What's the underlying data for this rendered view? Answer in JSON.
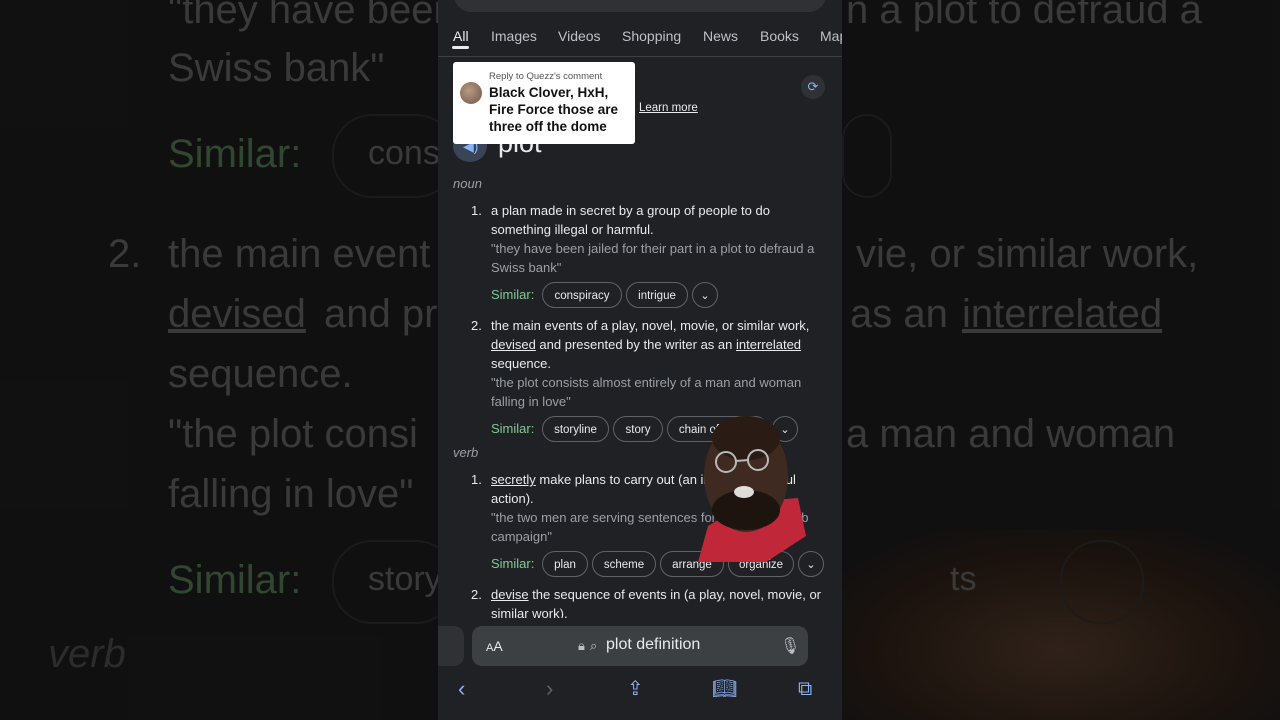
{
  "background": {
    "lines": [
      "\"they have been",
      "n a plot to defraud a",
      "Swiss bank\"",
      "Similar:",
      "cons",
      "2.",
      "the main event",
      "vie, or similar work,",
      "devised",
      "and pr",
      "as an",
      "interrelated",
      "sequence.",
      "\"the plot consi",
      "a man and woman",
      "falling in love\"",
      "Similar:",
      "story",
      "ts",
      "verb"
    ]
  },
  "tabs": [
    "All",
    "Images",
    "Videos",
    "Shopping",
    "News",
    "Books",
    "Map"
  ],
  "reply": {
    "meta": "Reply to Quezz's comment",
    "text": "Black Clover, HxH, Fire Force those are three off the dome"
  },
  "learn_more": "Learn more",
  "word": "plot",
  "senses": [
    {
      "pos": "noun",
      "definitions": [
        {
          "num": "1.",
          "text": "a plan made in secret by a group of people to do something illegal or harmful.",
          "example": "\"they have been jailed for their part in a plot to defraud a Swiss bank\"",
          "similar_label": "Similar:",
          "similar": [
            "conspiracy",
            "intrigue"
          ]
        },
        {
          "num": "2.",
          "text_parts": [
            "the main events of a play, novel, movie, or similar work, ",
            "devised",
            " and presented by the writer as an ",
            "interrelated",
            " sequence."
          ],
          "example": "\"the plot consists almost entirely of a man and woman falling in love\"",
          "similar_label": "Similar:",
          "similar": [
            "storyline",
            "story",
            "chain of events"
          ]
        }
      ]
    },
    {
      "pos": "verb",
      "definitions": [
        {
          "num": "1.",
          "text_parts": [
            "secretly",
            " make plans to carry out (an illegal or harmful action)."
          ],
          "example": "\"the two men are serving sentences for plotting a bomb campaign\"",
          "similar_label": "Similar:",
          "similar": [
            "plan",
            "scheme",
            "arrange",
            "organize"
          ]
        },
        {
          "num": "2.",
          "text_parts": [
            "devise",
            " the sequence of events in (a play, novel, movie, or similar work)."
          ]
        }
      ]
    }
  ],
  "addressbar": {
    "aa_big": "A",
    "aa_small": "A",
    "query": "plot definition"
  },
  "icons": [
    "back-icon",
    "forward-icon",
    "share-icon",
    "bookmarks-icon",
    "tabs-icon",
    "lock-icon",
    "search-icon",
    "mic-icon",
    "speaker-icon",
    "refresh-icon",
    "chevron-down-icon"
  ]
}
